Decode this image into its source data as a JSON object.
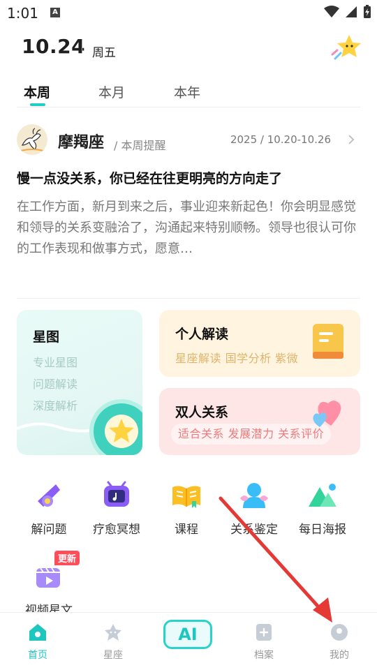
{
  "status_bar": {
    "time": "1:01",
    "notification_glyph": "A"
  },
  "header": {
    "date": "10.24",
    "weekday": "周五"
  },
  "tabs": [
    {
      "label": "本周",
      "active": true
    },
    {
      "label": "本月",
      "active": false
    },
    {
      "label": "本年",
      "active": false
    }
  ],
  "weekly": {
    "sign": "摩羯座",
    "subtitle": "/ 本周提醒",
    "range": "2025 / 10.20-10.26",
    "headline": "慢一点没关系，你已经在往更明亮的方向走了",
    "body": "在工作方面，新月到来之后，事业迎来新起色！你会明显感觉和领导的关系变融洽了，沟通起来特别顺畅。领导也很认可你的工作表现和做事方式，愿意…"
  },
  "cards": {
    "chart": {
      "title": "星图",
      "items": [
        "专业星图",
        "问题解读",
        "深度解析"
      ]
    },
    "reading": {
      "title": "个人解读",
      "subtitle": "星座解读 国学分析 紫微"
    },
    "pair": {
      "title": "双人关系",
      "subtitle": "适合关系 发展潜力 关系评价"
    }
  },
  "grid": [
    {
      "label": "解问题",
      "icon": "telescope-icon"
    },
    {
      "label": "疗愈冥想",
      "icon": "tv-music-icon"
    },
    {
      "label": "课程",
      "icon": "open-book-icon"
    },
    {
      "label": "关系鉴定",
      "icon": "two-people-icon"
    },
    {
      "label": "每日海报",
      "icon": "mountain-icon"
    },
    {
      "label": "视频星文",
      "icon": "video-clapper-icon",
      "badge": "更新"
    }
  ],
  "bottom_nav": {
    "items": [
      {
        "label": "首页",
        "icon": "home-icon",
        "active": true
      },
      {
        "label": "星座",
        "icon": "star-bear-icon",
        "active": false
      },
      {
        "label": "档案",
        "icon": "plus-file-icon",
        "active": false
      },
      {
        "label": "我的",
        "icon": "profile-icon",
        "active": false
      }
    ],
    "ai_label": "AI"
  },
  "colors": {
    "accent": "#1ec6c0",
    "annotation_arrow": "#e53935",
    "badge": "#ff4d5a"
  }
}
